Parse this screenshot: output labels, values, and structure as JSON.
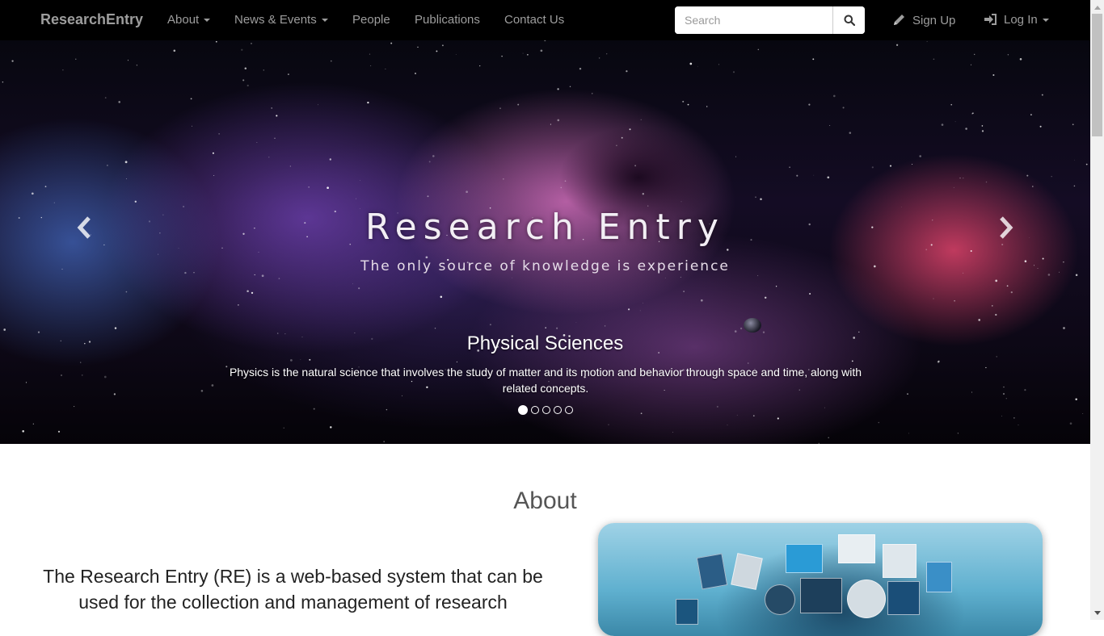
{
  "navbar": {
    "brand": "ResearchEntry",
    "items": [
      {
        "label": "About",
        "dropdown": true
      },
      {
        "label": "News & Events",
        "dropdown": true
      },
      {
        "label": "People",
        "dropdown": false
      },
      {
        "label": "Publications",
        "dropdown": false
      },
      {
        "label": "Contact Us",
        "dropdown": false
      }
    ],
    "search": {
      "placeholder": "Search",
      "value": ""
    },
    "signup_label": "Sign Up",
    "login_label": "Log In"
  },
  "hero": {
    "title": "Research Entry",
    "tagline": "The only source of knowledge is experience",
    "caption_title": "Physical Sciences",
    "caption_text": "Physics is the natural science that involves the study of matter and its motion and behavior through space and time, along with related concepts.",
    "slide_count": 5,
    "active_slide": 1
  },
  "about": {
    "heading": "About",
    "text": "The Research Entry (RE) is a web-based system that can be used for the collection and management of research"
  },
  "colors": {
    "navbar_bg": "#000000",
    "nav_text": "#9d9d9d",
    "page_bg": "#ffffff"
  }
}
